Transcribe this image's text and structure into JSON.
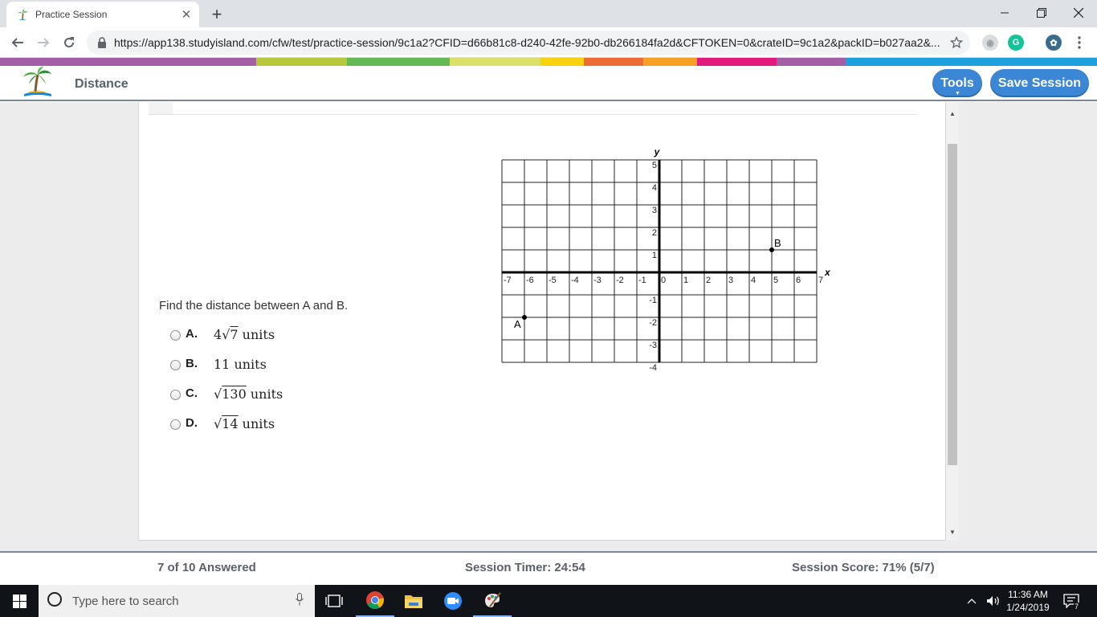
{
  "browser": {
    "tab_title": "Practice Session",
    "url": "https://app138.studyisland.com/cfw/test/practice-session/9c1a2?CFID=d66b81c8-d240-42fe-92b0-db266184fa2d&CFTOKEN=0&crateID=9c1a2&packID=b027aa2&..."
  },
  "colors": {
    "header_button": "#3b87d6",
    "brand_bar": [
      "#a45ea6",
      "#b7c93a",
      "#64b856",
      "#dbe168",
      "#f8d20b",
      "#ef6b35",
      "#f6a124",
      "#e21a7d",
      "#a45ea6",
      "#1ca0de"
    ]
  },
  "header": {
    "title": "Distance",
    "tools_label": "Tools",
    "save_label": "Save Session"
  },
  "graph": {
    "x_axis_label": "x",
    "y_axis_label": "y",
    "x_ticks": [
      "-7",
      "-6",
      "-5",
      "-4",
      "-3",
      "-2",
      "-1",
      "0",
      "1",
      "2",
      "3",
      "4",
      "5",
      "6",
      "7"
    ],
    "y_ticks": [
      "5",
      "4",
      "3",
      "2",
      "1",
      "-1",
      "-2",
      "-3",
      "-4"
    ],
    "points": [
      {
        "label": "A",
        "x": -6,
        "y": -2
      },
      {
        "label": "B",
        "x": 5,
        "y": 1
      }
    ]
  },
  "question": {
    "prompt": "Find the distance between A and B.",
    "options": [
      {
        "letter": "A.",
        "coef": "4",
        "radicand": "7",
        "text": "units"
      },
      {
        "letter": "B.",
        "value": "11 units"
      },
      {
        "letter": "C.",
        "radicand": "130",
        "text": "units"
      },
      {
        "letter": "D.",
        "radicand": "14",
        "text": "units"
      }
    ]
  },
  "footer": {
    "answered": "7 of 10 Answered",
    "timer": "Session Timer: 24:54",
    "score": "Session Score: 71% (5/7)"
  },
  "taskbar": {
    "search_placeholder": "Type here to search",
    "time": "11:36 AM",
    "date": "1/24/2019"
  }
}
